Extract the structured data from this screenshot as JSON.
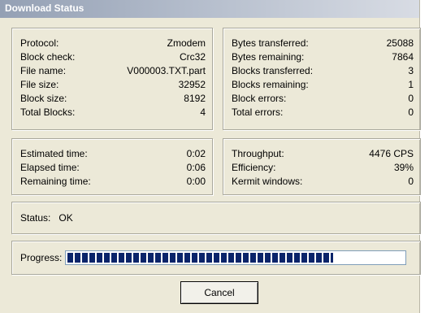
{
  "window": {
    "title": "Download Status"
  },
  "transfer_info": [
    {
      "label": "Protocol:",
      "value": "Zmodem"
    },
    {
      "label": "Block check:",
      "value": "Crc32"
    },
    {
      "label": "File name:",
      "value": "V000003.TXT.part"
    },
    {
      "label": "File size:",
      "value": "32952"
    },
    {
      "label": "Block size:",
      "value": "8192"
    },
    {
      "label": "Total Blocks:",
      "value": "4"
    }
  ],
  "transfer_stats": [
    {
      "label": "Bytes transferred:",
      "value": "25088"
    },
    {
      "label": "Bytes remaining:",
      "value": "7864"
    },
    {
      "label": "Blocks transferred:",
      "value": "3"
    },
    {
      "label": "Blocks remaining:",
      "value": "1"
    },
    {
      "label": "Block errors:",
      "value": "0"
    },
    {
      "label": "Total errors:",
      "value": "0"
    }
  ],
  "time_info": [
    {
      "label": "Estimated time:",
      "value": "0:02"
    },
    {
      "label": "Elapsed time:",
      "value": "0:06"
    },
    {
      "label": "Remaining time:",
      "value": "0:00"
    }
  ],
  "rate_info": [
    {
      "label": "Throughput:",
      "value": "4476 CPS"
    },
    {
      "label": "Efficiency:",
      "value": "39%"
    },
    {
      "label": "Kermit windows:",
      "value": "0"
    }
  ],
  "status": {
    "label": "Status:",
    "value": "OK"
  },
  "progress": {
    "label": "Progress:",
    "fraction": 0.79,
    "bar_color": "#0a246a"
  },
  "buttons": {
    "cancel_label": "Cancel"
  }
}
